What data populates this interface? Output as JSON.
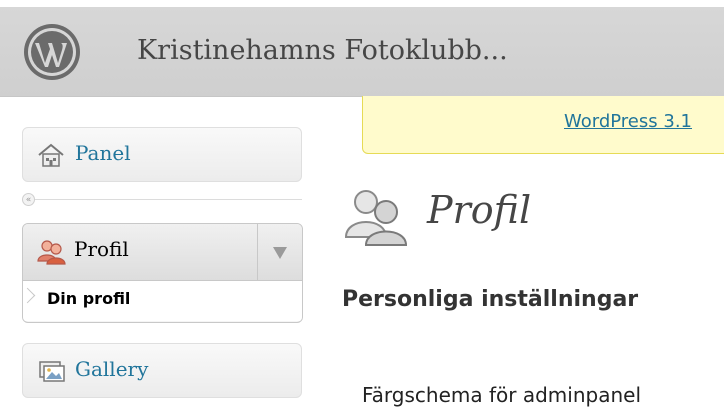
{
  "header": {
    "site_title": "Kristinehamns Fotoklubb...",
    "logo_icon": "wordpress-logo-icon"
  },
  "sidebar": {
    "items": [
      {
        "label": "Panel",
        "icon": "dashboard-home-icon"
      },
      {
        "label": "Profil",
        "icon": "users-icon",
        "submenu": [
          {
            "label": "Din profil"
          }
        ]
      },
      {
        "label": "Gallery",
        "icon": "gallery-icon"
      }
    ],
    "collapse_glyph": "«"
  },
  "notice": {
    "link_text": "WordPress 3.1"
  },
  "main": {
    "page_title": "Profil",
    "page_icon": "users-large-icon",
    "section_title": "Personliga inställningar",
    "color_scheme_label": "Färgschema för adminpanel"
  },
  "colors": {
    "link": "#21759b",
    "header_bg": "#d3d3d3",
    "notice_bg": "#fffbcc",
    "notice_border": "#e6db55"
  }
}
